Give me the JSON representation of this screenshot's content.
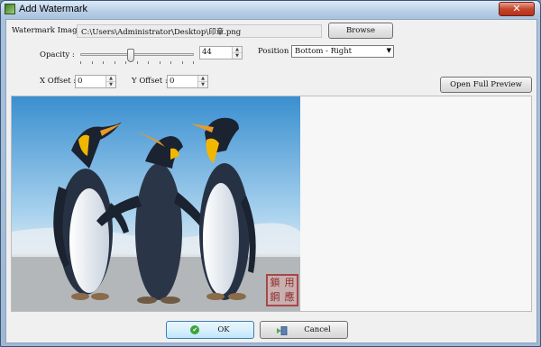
{
  "window": {
    "title": "Add Watermark",
    "close_label": "✕"
  },
  "watermark_image": {
    "label": "Watermark Image :",
    "path": "C:\\Users\\Administrator\\Desktop\\印章.png",
    "browse_label": "Browse"
  },
  "opacity": {
    "label": "Opacity :",
    "value": "44",
    "fraction": 0.44
  },
  "position": {
    "label": "Position :",
    "selected": "Bottom - Right"
  },
  "x_offset": {
    "label": "X Offset :",
    "value": "0"
  },
  "y_offset": {
    "label": "Y Offset :",
    "value": "0"
  },
  "preview": {
    "full_preview_label": "Open Full Preview"
  },
  "stamp": {
    "chars": [
      "鎖",
      "用",
      "鋼",
      "應"
    ]
  },
  "footer": {
    "ok_label": "OK",
    "cancel_label": "Cancel"
  },
  "icons": {
    "app": "watermark-app-icon",
    "close": "close-icon",
    "ok": "check-circle-icon",
    "cancel": "cancel-door-icon",
    "spin_up": "spin-up-icon",
    "spin_down": "spin-down-icon",
    "dropdown": "chevron-down-icon"
  },
  "colors": {
    "title_bar": "#b9cfe6",
    "close_button": "#c4452c",
    "ok_icon": "#3aa43a",
    "stamp": "#a74747"
  }
}
